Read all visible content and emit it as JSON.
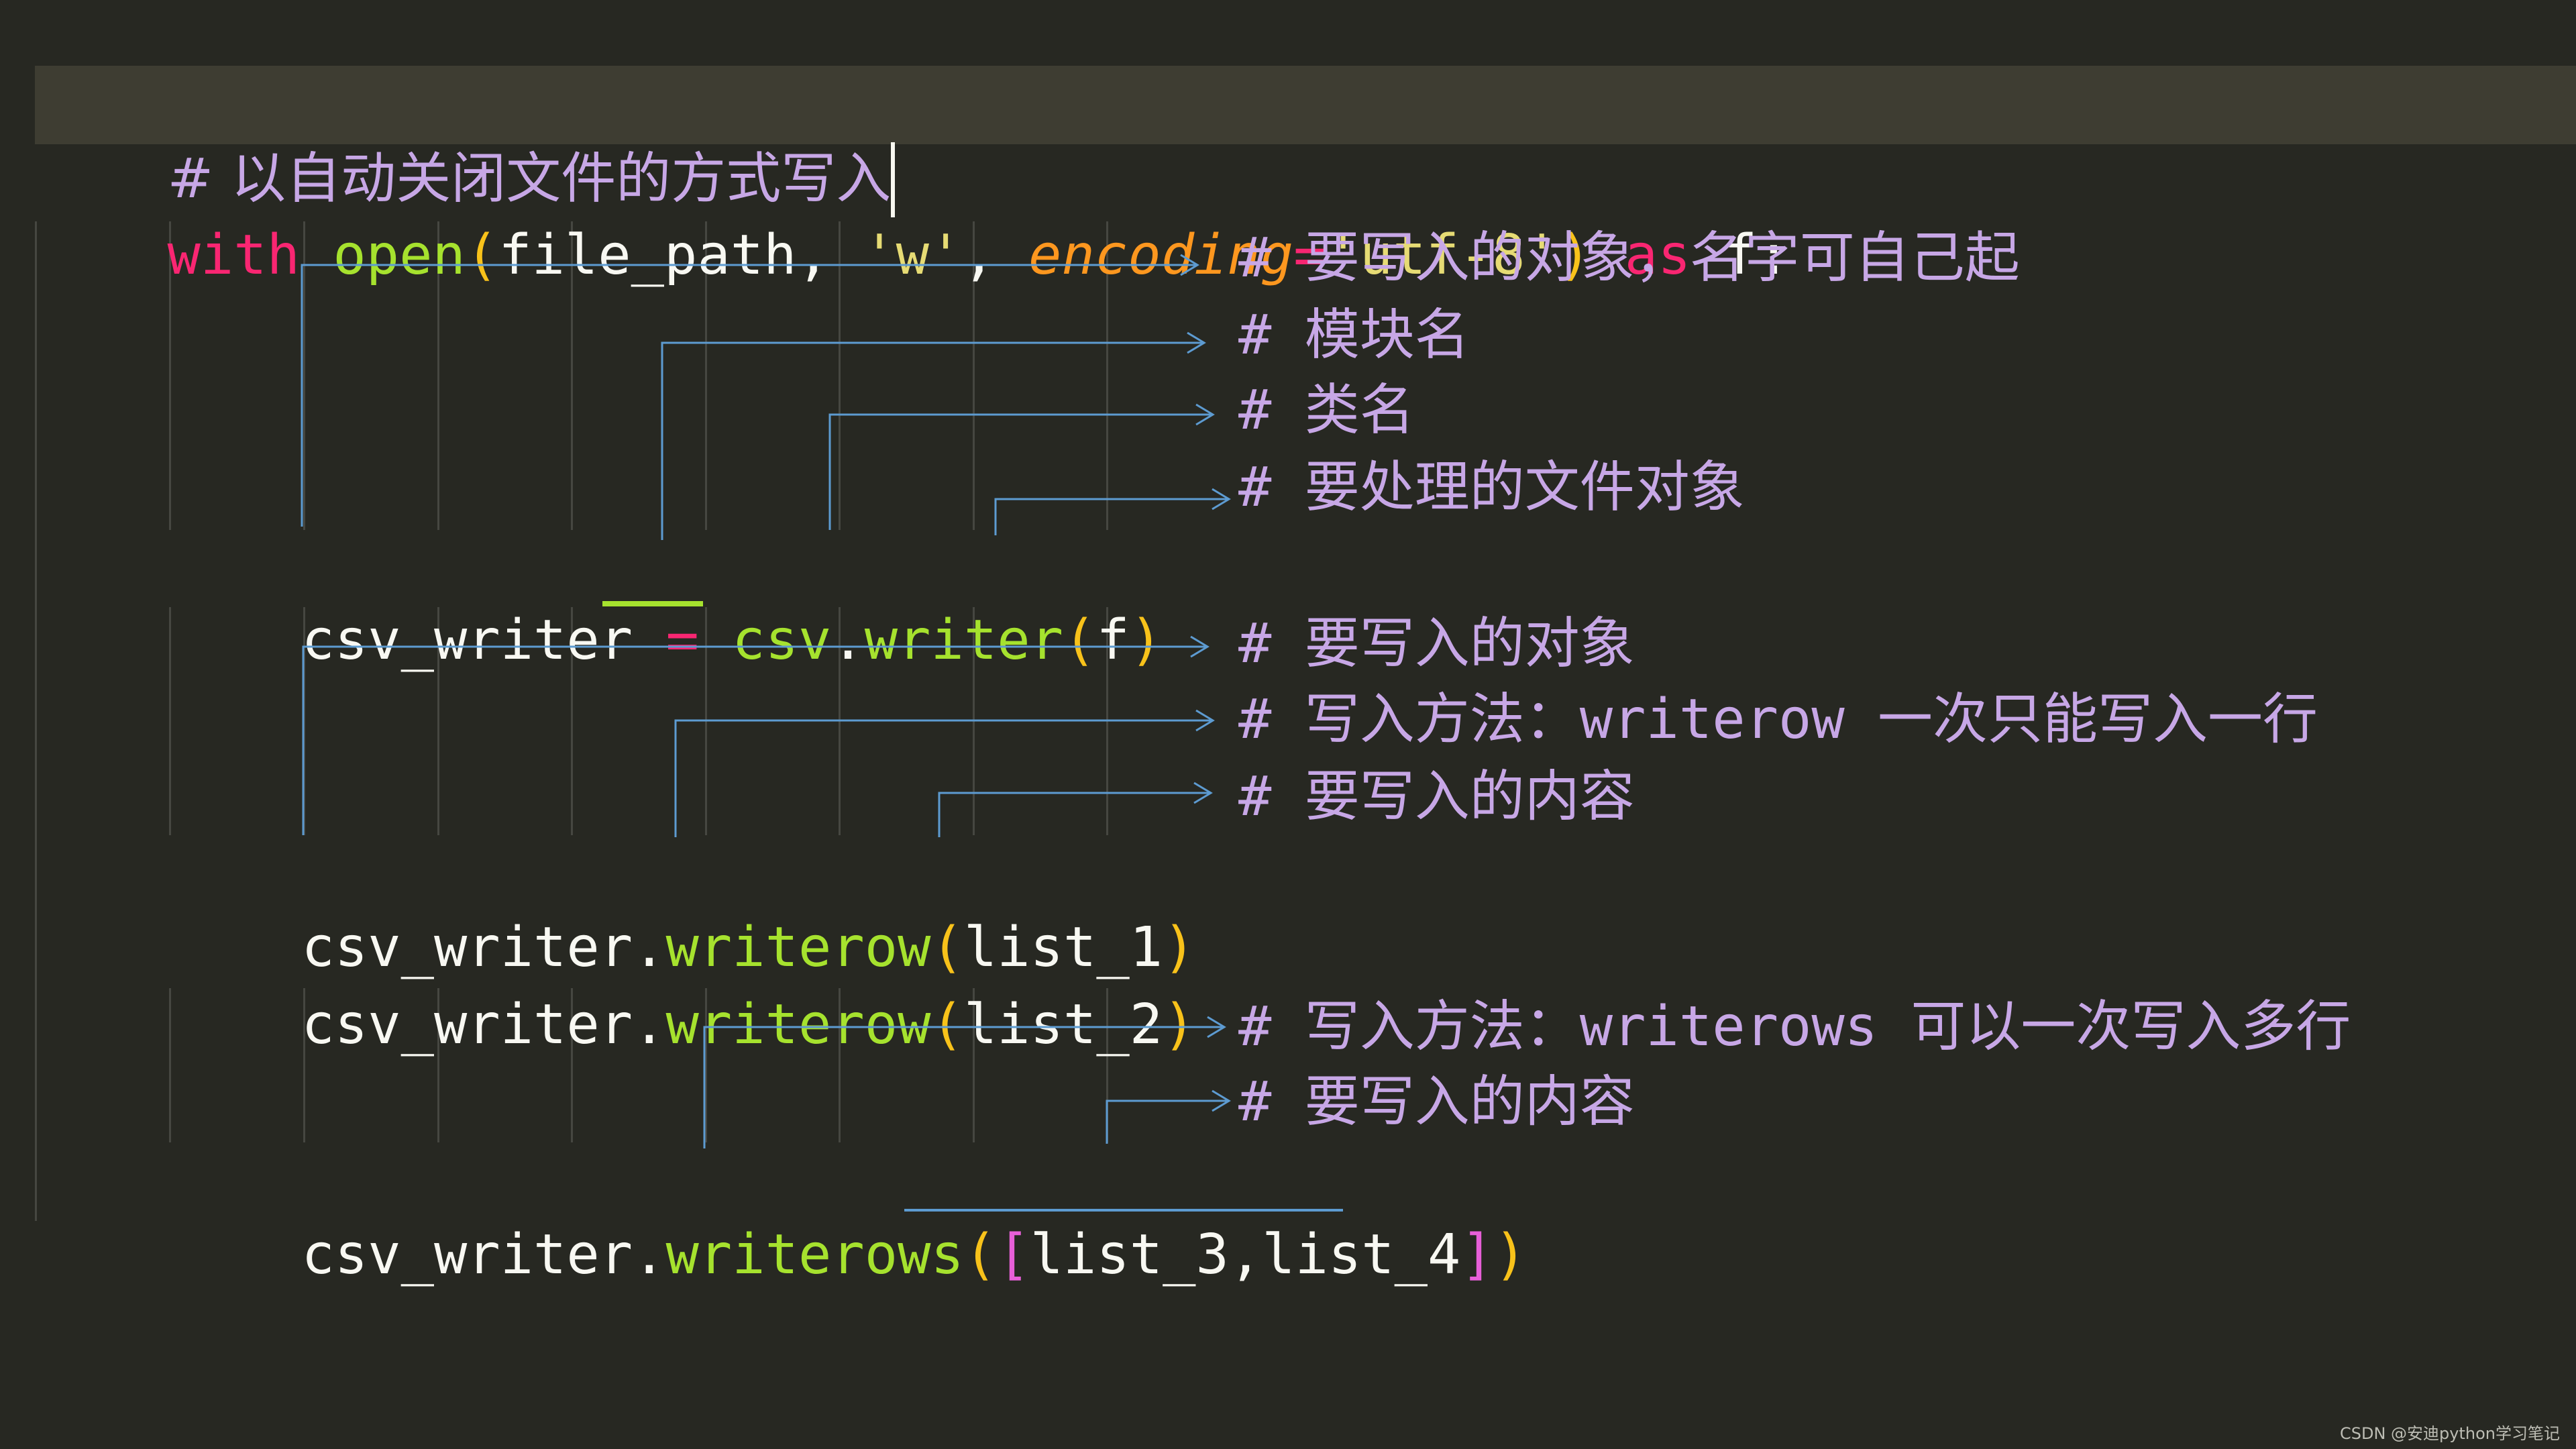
{
  "editor": {
    "theme_colors": {
      "background": "#272822",
      "active_line": "#3e3d32",
      "comment": "#c7a7e6",
      "keyword": "#f92672",
      "function": "#a6e22e",
      "paren": "#f8c21a",
      "plain": "#f8f8f2",
      "string": "#e6db74",
      "param": "#fd971f",
      "bracket": "#e75fd8",
      "arrow": "#5d9bd1",
      "indent_guide": "#464741"
    },
    "code": {
      "line1_comment": "# 以自动关闭文件的方式写入",
      "line2": {
        "kw_with": "with",
        "fn_open": "open",
        "lparen": "(",
        "arg_file_path": "file_path",
        "comma1": ", ",
        "str_w": "'w'",
        "comma2": ", ",
        "param_encoding": "encoding",
        "eq": "=",
        "str_utf8": "'utf-8'",
        "rparen": ")",
        "kw_as": " as ",
        "var_f": "f:"
      },
      "line3": {
        "var": "csv_writer",
        "eq": " = ",
        "module": "csv",
        "dot": ".",
        "cls": "writer",
        "lparen": "(",
        "arg": "f",
        "rparen": ")"
      },
      "line4": {
        "obj": "csv_writer.",
        "method": "writerow",
        "lparen": "(",
        "arg": "list_1",
        "rparen": ")"
      },
      "line5": {
        "obj": "csv_writer.",
        "method": "writerow",
        "lparen": "(",
        "arg": "list_2",
        "rparen": ")"
      },
      "line6": {
        "obj": "csv_writer.",
        "method": "writerows",
        "lparen": "(",
        "lbracket": "[",
        "arg": "list_3,list_4",
        "rbracket": "]",
        "rparen": ")"
      }
    },
    "annotations": [
      "# 要写入的对象，名字可自己起",
      "# 模块名",
      "# 类名",
      "# 要处理的文件对象",
      "# 要写入的对象",
      "# 写入方法：writerow 一次只能写入一行",
      "# 要写入的内容",
      "# 写入方法：writerows 可以一次写入多行",
      "# 要写入的内容"
    ]
  },
  "watermark": "CSDN @安迪python学习笔记"
}
